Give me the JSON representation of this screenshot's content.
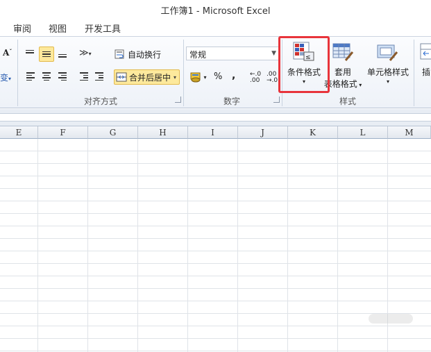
{
  "window": {
    "title": "工作簿1  -  Microsoft Excel"
  },
  "menu_tabs": [
    "审阅",
    "视图",
    "开发工具"
  ],
  "ribbon": {
    "alignment": {
      "wrap_text": "自动换行",
      "merge_center": "合并后居中",
      "group_label": "对齐方式"
    },
    "number": {
      "format_value": "常规",
      "percent": "%",
      "comma": ",",
      "group_label": "数字"
    },
    "styles": {
      "conditional_format": "条件格式",
      "table_format_line1": "套用",
      "table_format_line2": "表格格式",
      "cell_styles": "单元格样式",
      "group_label": "样式"
    },
    "cells": {
      "insert_partial": "插"
    },
    "font": {
      "size_a": "A",
      "partial_glyph": "变"
    }
  },
  "columns": [
    "E",
    "F",
    "G",
    "H",
    "I",
    "J",
    "K",
    "L",
    "M"
  ],
  "colors": {
    "highlight": "#fde99c",
    "red_outline": "#e8343b"
  }
}
